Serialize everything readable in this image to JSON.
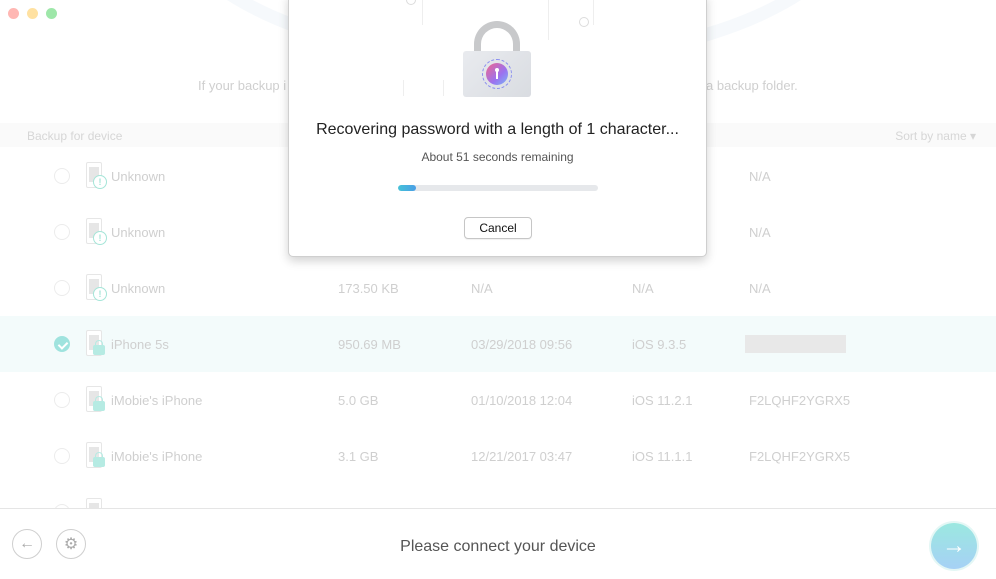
{
  "window": {
    "controls": [
      "close",
      "minimize",
      "maximize"
    ]
  },
  "hint": {
    "left_fragment": "If your backup i",
    "right_fragment": "a backup folder."
  },
  "table": {
    "header_title": "Backup for device",
    "sort_label": "Sort by name",
    "rows": [
      {
        "name": "Unknown",
        "size": "",
        "date": "",
        "ios": "",
        "serial": "N/A",
        "status_icon": "warning-icon",
        "selected": false
      },
      {
        "name": "Unknown",
        "size": "",
        "date": "",
        "ios": "",
        "serial": "N/A",
        "status_icon": "warning-icon",
        "selected": false
      },
      {
        "name": "Unknown",
        "size": "173.50 KB",
        "date": "N/A",
        "ios": "N/A",
        "serial": "N/A",
        "status_icon": "warning-icon",
        "selected": false
      },
      {
        "name": "iPhone 5s",
        "size": "950.69 MB",
        "date": "03/29/2018 09:56",
        "ios": "iOS 9.3.5",
        "serial": "",
        "serial_redacted": true,
        "status_icon": "lock-icon",
        "selected": true
      },
      {
        "name": "iMobie's iPhone",
        "size": "5.0 GB",
        "date": "01/10/2018 12:04",
        "ios": "iOS 11.2.1",
        "serial": "F2LQHF2YGRX5",
        "status_icon": "lock-icon",
        "selected": false
      },
      {
        "name": "iMobie's iPhone",
        "size": "3.1 GB",
        "date": "12/21/2017 03:47",
        "ios": "iOS 11.1.1",
        "serial": "F2LQHF2YGRX5",
        "status_icon": "lock-icon",
        "selected": false
      }
    ]
  },
  "dialog": {
    "title": "Recovering password with a length of 1 character...",
    "subtitle": "About 51 seconds remaining",
    "progress_percent": 9,
    "cancel_label": "Cancel",
    "colors": {
      "progress_start": "#45c2d8",
      "progress_end": "#4a9ee6"
    }
  },
  "footer": {
    "status": "Please connect your device",
    "back_icon": "←",
    "settings_icon": "⚙",
    "next_icon": "→"
  }
}
